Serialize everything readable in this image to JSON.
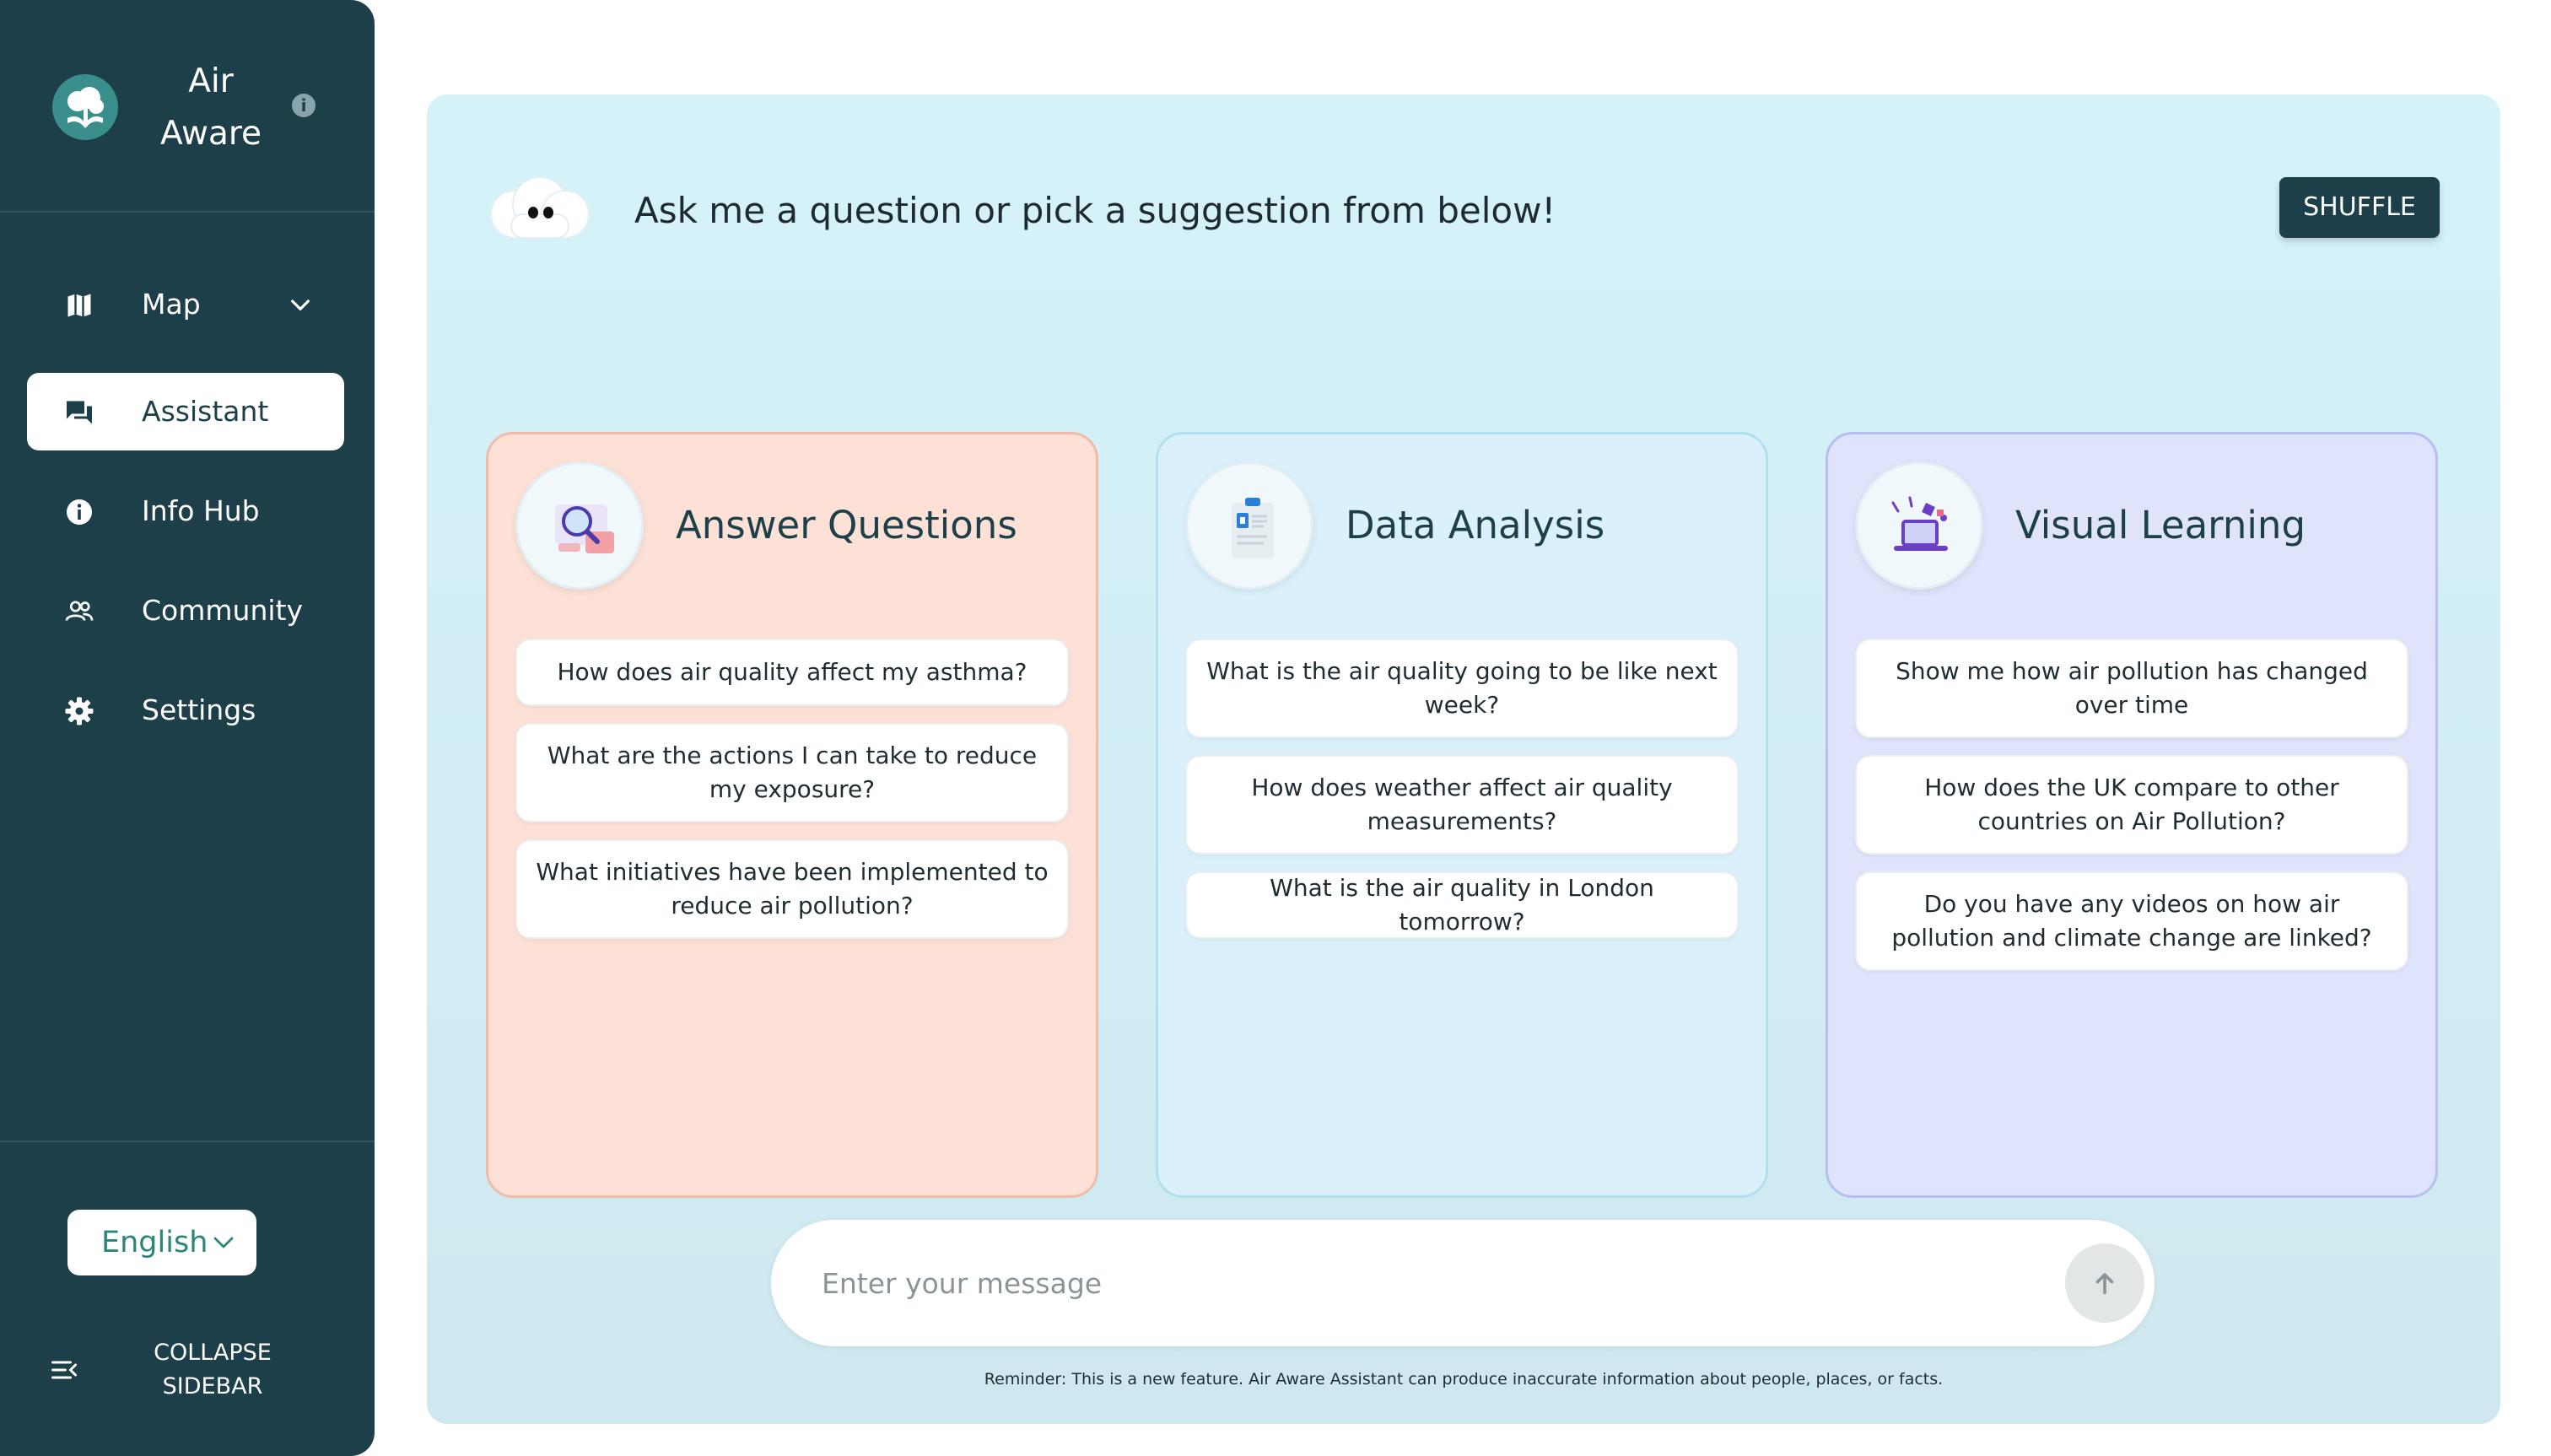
{
  "app": {
    "title": "Air Aware"
  },
  "sidebar": {
    "items": [
      {
        "label": "Map",
        "icon": "map-icon",
        "expandable": true
      },
      {
        "label": "Assistant",
        "icon": "chat-icon",
        "active": true
      },
      {
        "label": "Info Hub",
        "icon": "info-icon"
      },
      {
        "label": "Community",
        "icon": "people-icon"
      },
      {
        "label": "Settings",
        "icon": "gear-icon"
      }
    ],
    "language": "English",
    "collapse_label": "COLLAPSE SIDEBAR"
  },
  "main": {
    "prompt": "Ask me a question or pick a suggestion from below!",
    "shuffle_label": "SHUFFLE",
    "cards": [
      {
        "title": "Answer Questions",
        "icon": "magnifier-illustration-icon",
        "suggestions": [
          "How does air quality affect my asthma?",
          "What are the actions I can take to reduce my exposure?",
          "What initiatives have been implemented to reduce air pollution?"
        ]
      },
      {
        "title": "Data Analysis",
        "icon": "clipboard-illustration-icon",
        "suggestions": [
          "What is the air quality going to be like next week?",
          "How does weather affect air quality measurements?",
          "What is the air quality in London tomorrow?"
        ]
      },
      {
        "title": "Visual Learning",
        "icon": "laptop-illustration-icon",
        "suggestions": [
          "Show me how air pollution has changed over time",
          "How does the UK compare to other countries on Air Pollution?",
          "Do you have any videos on how air pollution and climate change are linked?"
        ]
      }
    ],
    "input": {
      "placeholder": "Enter your message",
      "value": ""
    },
    "reminder": "Reminder: This is a new feature. Air Aware Assistant can produce inaccurate information about people, places, or facts."
  },
  "colors": {
    "sidebar_bg": "#1c3f49",
    "accent": "#2c8579",
    "card_answer": "#fde1d7",
    "card_data": "#daf1fb",
    "card_visual": "#dfe3fb"
  }
}
